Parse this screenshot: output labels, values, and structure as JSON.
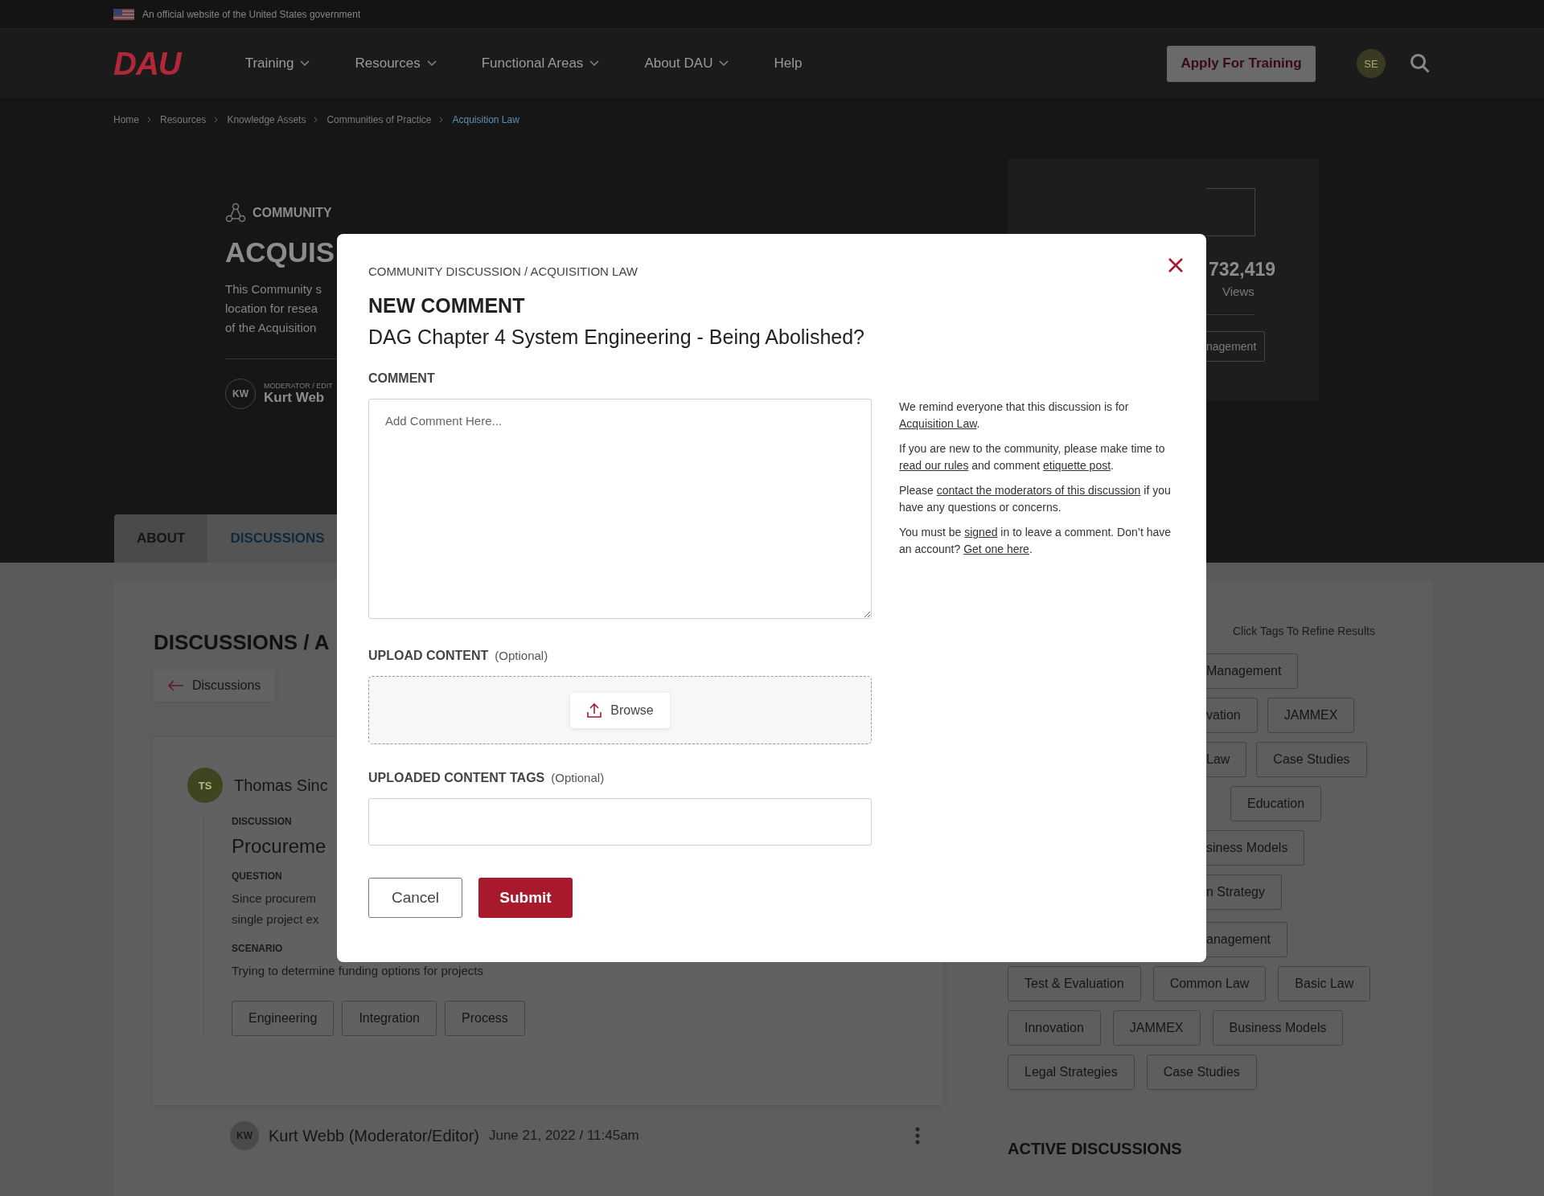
{
  "gov_banner": {
    "text": "An official website of the United States government"
  },
  "nav": {
    "logo": "DAU",
    "items": [
      {
        "label": "Training",
        "dropdown": true
      },
      {
        "label": "Resources",
        "dropdown": true
      },
      {
        "label": "Functional Areas",
        "dropdown": true
      },
      {
        "label": "About DAU",
        "dropdown": true
      },
      {
        "label": "Help",
        "dropdown": false
      }
    ],
    "apply_button": "Apply For Training",
    "avatar": "SE"
  },
  "breadcrumb": [
    {
      "label": "Home",
      "selected": false
    },
    {
      "label": "Resources",
      "selected": false
    },
    {
      "label": "Knowledge Assets",
      "selected": false
    },
    {
      "label": "Communities of Practice",
      "selected": false
    },
    {
      "label": "Acquisition Law",
      "selected": true
    }
  ],
  "hero": {
    "eyebrow": "COMMUNITY",
    "title": "ACQUIS",
    "description": [
      "This Community s",
      "location for resea",
      "of the Acquisition"
    ],
    "moderator": {
      "initials": "KW",
      "role": "MODERATOR / EDIT",
      "name": "Kurt Web"
    }
  },
  "stats_panel": {
    "count": "732,419",
    "label": "Views",
    "tag": "nagement"
  },
  "tabs": [
    {
      "label": "ABOUT",
      "selected": false
    },
    {
      "label": "DISCUSSIONS",
      "selected": true
    }
  ],
  "discussions": {
    "heading": "DISCUSSIONS / A",
    "back_button": "Discussions",
    "post": {
      "initials": "TS",
      "author": "Thomas Sinc",
      "type_label": "DISCUSSION",
      "title": "Procureme",
      "question_label": "QUESTION",
      "question": [
        "Since procurem",
        "single project ex"
      ],
      "scenario_label": "SCENARIO",
      "scenario": "Trying to determine funding options for projects",
      "tags": [
        "Engineering",
        "Integration",
        "Process"
      ]
    },
    "reply": {
      "initials": "KW",
      "author": "Kurt Webb (Moderator/Editor)",
      "date": "June 21, 2022 / 11:45am"
    }
  },
  "tag_panel": {
    "hint": "Click Tags To Refine Results",
    "partial_rows": [
      [
        "Management"
      ],
      [
        "vation",
        "JAMMEX"
      ],
      [
        "Law",
        "Case Studies"
      ],
      [
        "Education"
      ],
      [
        "siness Models"
      ],
      [
        "n Strategy"
      ],
      [
        "anagement"
      ]
    ],
    "rows": [
      [
        "Test & Evaluation",
        "Common Law",
        "Basic Law"
      ],
      [
        "Innovation",
        "JAMMEX",
        "Business Models"
      ],
      [
        "Legal Strategies",
        "Case Studies"
      ]
    ]
  },
  "active_discussions_heading": "ACTIVE DISCUSSIONS",
  "modal": {
    "breadcrumb": "COMMUNITY DISCUSSION / ACQUISITION LAW",
    "heading": "NEW COMMENT",
    "title": "DAG Chapter 4 System Engineering - Being Abolished?",
    "comment_label": "COMMENT",
    "comment_placeholder": "Add Comment Here...",
    "notes": [
      [
        {
          "text": "We remind everyone that this discussion is for "
        },
        {
          "text": "Acquisition Law",
          "link": true
        },
        {
          "text": "."
        }
      ],
      [
        {
          "text": "If you are new to the community, please make time to "
        },
        {
          "text": "read our rules",
          "link": true
        },
        {
          "text": " and comment "
        },
        {
          "text": "etiquette post",
          "link": true
        },
        {
          "text": "."
        }
      ],
      [
        {
          "text": "Please "
        },
        {
          "text": "contact the moderators of this discussion",
          "link": true
        },
        {
          "text": " if you have any questions or concerns."
        }
      ],
      [
        {
          "text": "You must be "
        },
        {
          "text": "signed",
          "link": true
        },
        {
          "text": " in to leave a comment. Don’t have an account? "
        },
        {
          "text": "Get one here",
          "link": true
        },
        {
          "text": "."
        }
      ]
    ],
    "upload_label": "UPLOAD CONTENT",
    "upload_optional": "(Optional)",
    "browse_button": "Browse",
    "tags_label": "UPLOADED CONTENT TAGS",
    "tags_optional": "(Optional)",
    "cancel_button": "Cancel",
    "submit_button": "Submit"
  }
}
